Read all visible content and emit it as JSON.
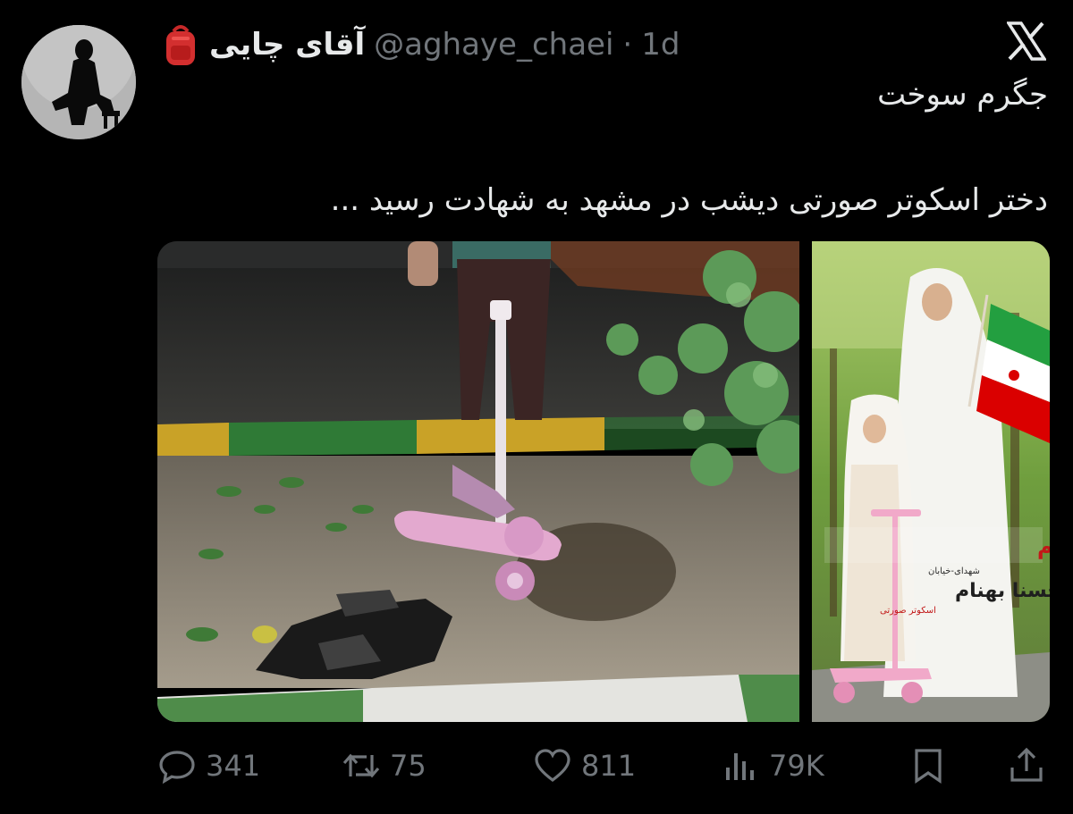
{
  "author": {
    "display_name": "آقای چایی",
    "handle": "@aghaye_chaei",
    "separator": "·",
    "time": "1d",
    "emoji_icon": "backpack-icon"
  },
  "platform_icon": "x-logo-icon",
  "tweet": {
    "line1": "جگرم سوخت",
    "line2": "دختر اسکوتر صورتی دیشب در مشهد به شهادت رسید ..."
  },
  "media": {
    "left_photo": "debris-pink-scooter-photo",
    "right_photo": "mother-daughter-flag-poster",
    "poster_text_1": "شهیده محدثه خوشکام",
    "poster_caption_1": "شهدای-خیابان",
    "poster_text_2": "شهیده حسنا بهنام",
    "poster_caption_2": "اسکوتر صورتی"
  },
  "actions": {
    "replies": "341",
    "reposts": "75",
    "likes": "811",
    "views": "79K"
  },
  "colors": {
    "background": "#000000",
    "text": "#e7e9ea",
    "muted": "#71767b"
  }
}
